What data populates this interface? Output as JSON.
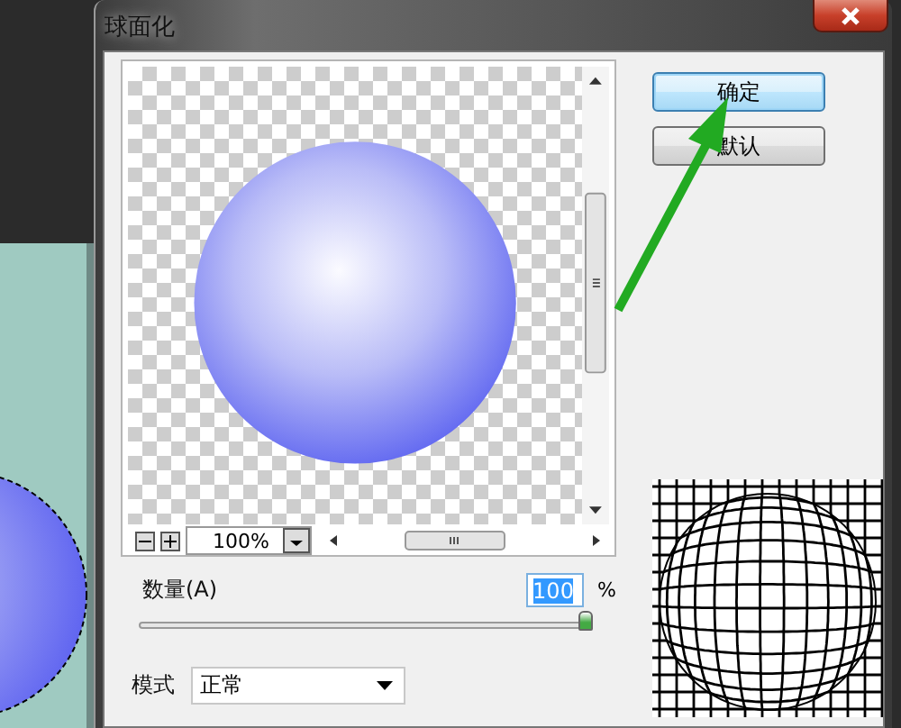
{
  "window": {
    "title": "球面化"
  },
  "buttons": [
    {
      "label": "确定",
      "focused": true
    },
    {
      "label": "默认",
      "focused": false
    }
  ],
  "preview": {
    "zoom": "100%"
  },
  "amount": {
    "label": "数量(A)",
    "value": "100",
    "text_selected": true,
    "unit": "%",
    "level": 1
  },
  "mode": {
    "label": "模式",
    "value": "正常"
  }
}
